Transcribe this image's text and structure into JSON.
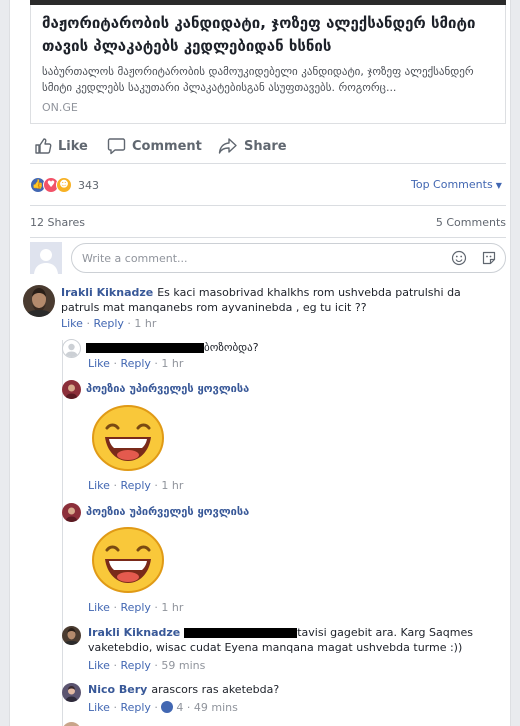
{
  "link_preview": {
    "title": "მაჟორიტარობის კანდიდატი, ჯოზეფ ალექსანდერ სმიტი თავის პლაკატებს კედლებიდან ხსნის",
    "description": "საბურთალოს მაჟორიტარობის დამოუკიდებელი კანდიდატი, ჯოზეფ ალექსანდერ სმიტი კედლებს საკუთარი პლაკატებისგან ასუფთავებს. როგორც...",
    "domain": "ON.GE"
  },
  "actions": {
    "like": "Like",
    "comment": "Comment",
    "share": "Share"
  },
  "reactions": {
    "count": "343",
    "sort_label": "Top Comments",
    "types": [
      "like-icon",
      "love-icon",
      "haha-icon"
    ],
    "colors": {
      "like": "#4267b2",
      "love": "#f25268",
      "haha": "#f7b125"
    }
  },
  "stats": {
    "shares": "12 Shares",
    "comments": "5 Comments"
  },
  "composer": {
    "placeholder": "Write a comment..."
  },
  "comments": [
    {
      "name": "Irakli Kiknadze",
      "text": "Es kaci masobrivad khalkhs rom ushvebda patrulshi da patruls mat manqanebs rom ayvaninebda , eg tu icit ??",
      "like": "Like",
      "reply": "Reply",
      "time": "1 hr"
    },
    {
      "name": "",
      "text": "ბოზობდა?",
      "like": "Like",
      "reply": "Reply",
      "time": "1 hr"
    },
    {
      "name": "პოეზია უპირველეს ყოვლისა",
      "sticker": "laughing-face-sticker",
      "like": "Like",
      "reply": "Reply",
      "time": "1 hr"
    },
    {
      "name": "პოეზია უპირველეს ყოვლისა",
      "sticker": "laughing-face-sticker",
      "like": "Like",
      "reply": "Reply",
      "time": "1 hr"
    },
    {
      "name": "Irakli Kiknadze",
      "text_after": "tavisi gagebit ara. Karg Saqmes vaketebdio, wisac cudat Eyena manqana magat ushvebda turme :))",
      "like": "Like",
      "reply": "Reply",
      "time": "59 mins"
    },
    {
      "name": "Nico Bery",
      "text": "arascors ras aketebda?",
      "like": "Like",
      "reply": "Reply",
      "likes": "4",
      "time": "49 mins"
    }
  ],
  "separator": "·"
}
